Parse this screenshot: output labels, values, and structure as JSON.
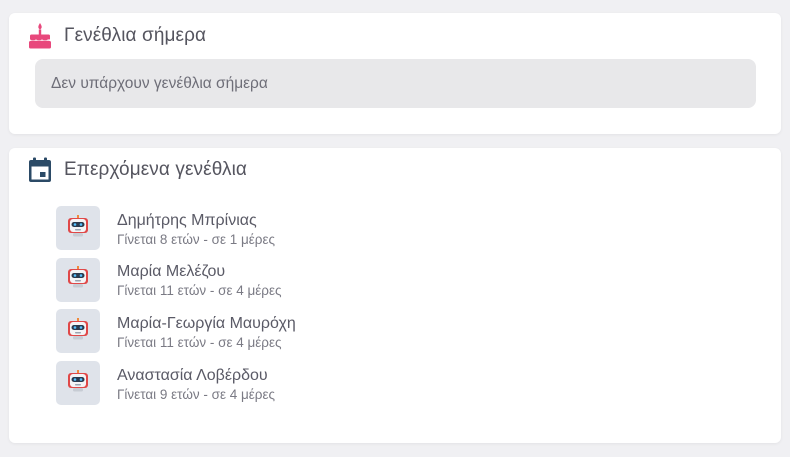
{
  "today": {
    "title": "Γενέθλια σήμερα",
    "icon": "cake-icon",
    "icon_color": "#e8487c",
    "empty_message": "Δεν υπάρχουν γενέθλια σήμερα"
  },
  "upcoming": {
    "title": "Επερχόμενα γενέθλια",
    "icon": "calendar-icon",
    "icon_color": "#2b4a66",
    "people": [
      {
        "name": "Δημήτρης Μπρίνιας",
        "detail": "Γίνεται 8 ετών - σε 1 μέρες",
        "avatar": "robot-icon"
      },
      {
        "name": "Μαρία Μελέζου",
        "detail": "Γίνεται 11 ετών - σε 4 μέρες",
        "avatar": "robot-icon"
      },
      {
        "name": "Μαρία-Γεωργία Μαυρόχη",
        "detail": "Γίνεται 11 ετών - σε 4 μέρες",
        "avatar": "robot-icon"
      },
      {
        "name": "Αναστασία Λοβέρδου",
        "detail": "Γίνεται 9 ετών - σε 4 μέρες",
        "avatar": "robot-icon"
      }
    ]
  }
}
